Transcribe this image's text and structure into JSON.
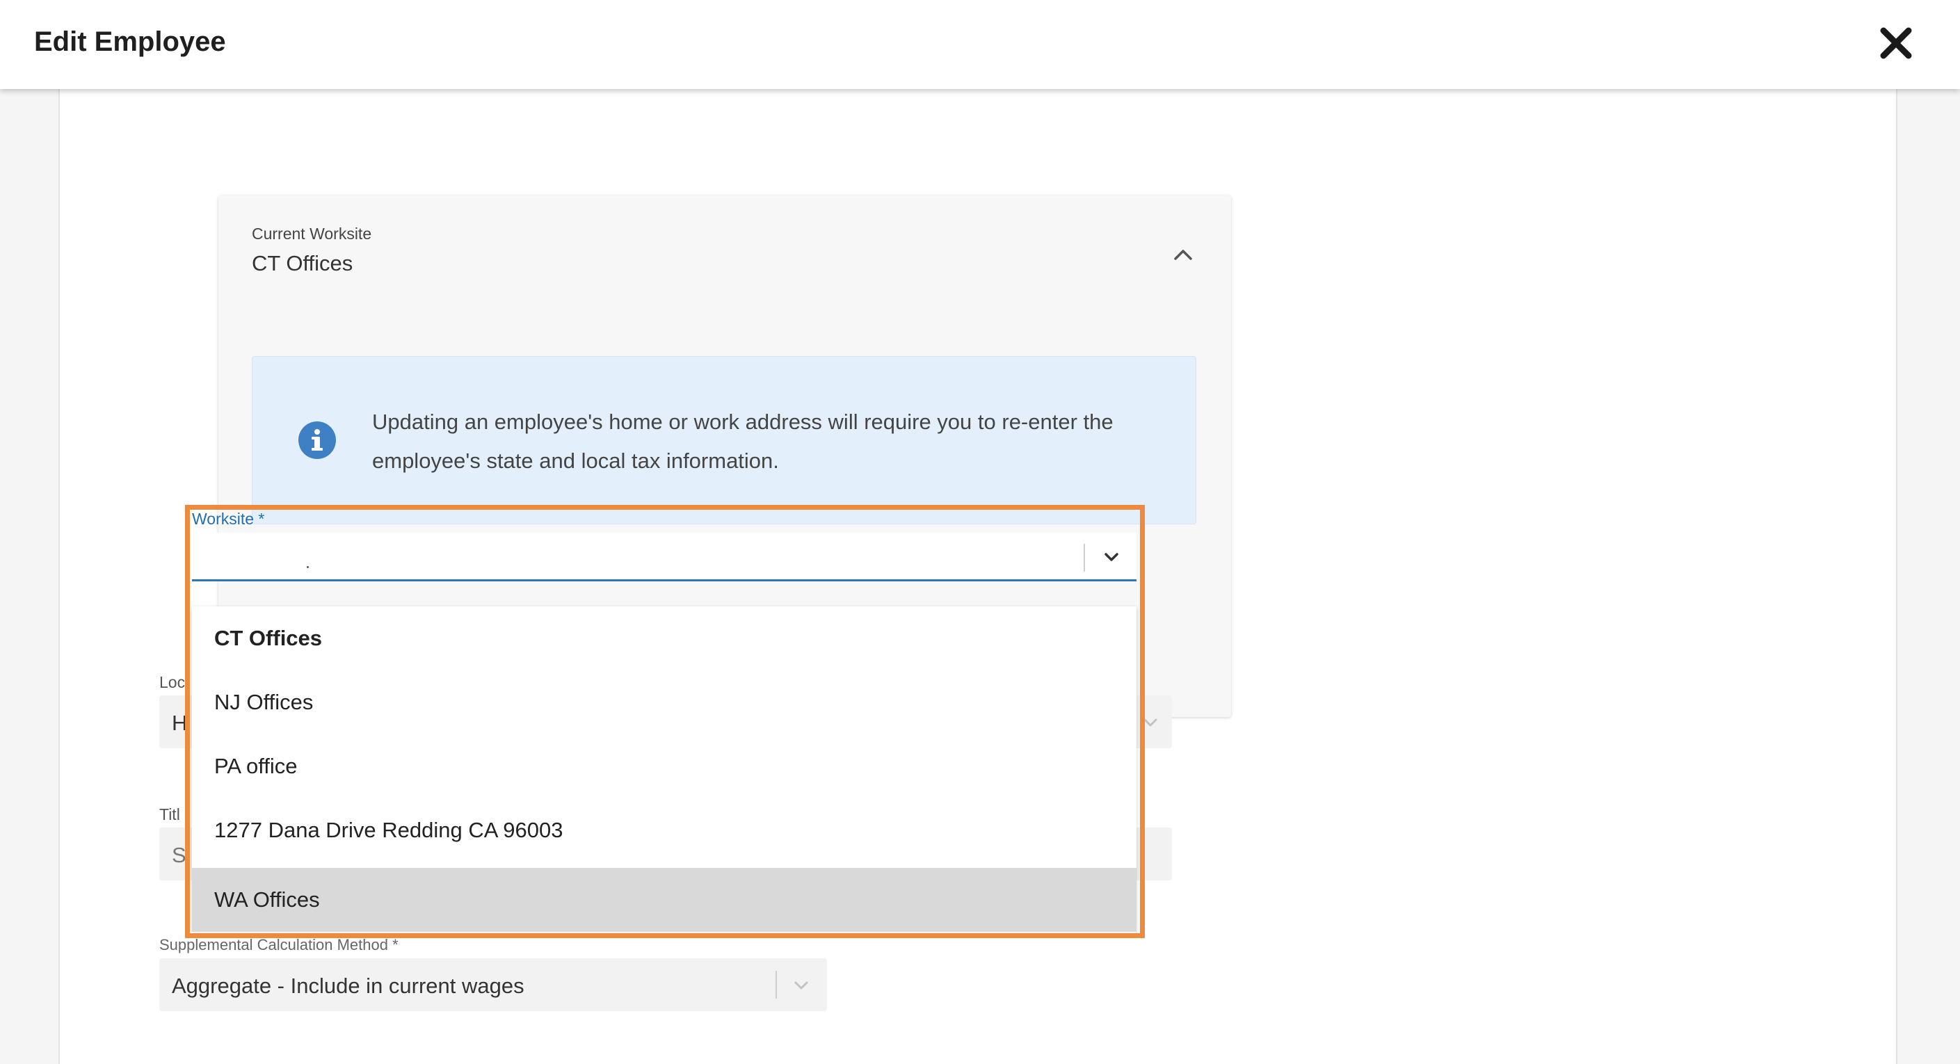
{
  "header": {
    "title": "Edit Employee"
  },
  "current_worksite": {
    "label": "Current Worksite",
    "value": "CT Offices"
  },
  "info": {
    "message": "Updating an employee's home or work address will require you to re-enter the employee's state and local tax information."
  },
  "worksite_field": {
    "label": "Worksite *",
    "value": "",
    "options": [
      {
        "label": "CT Offices",
        "selected": true
      },
      {
        "label": "NJ Offices",
        "selected": false
      },
      {
        "label": "PA office",
        "selected": false
      },
      {
        "label": "1277 Dana Drive Redding CA 96003",
        "selected": false
      },
      {
        "label": "WA Offices",
        "selected": false,
        "hovered": true
      }
    ]
  },
  "location_field": {
    "label_fragment": "Loc",
    "value_fragment": "H"
  },
  "title_field": {
    "label_fragment": "Titl",
    "value_fragment": "S"
  },
  "supplemental_field": {
    "label": "Supplemental Calculation Method *",
    "value": "Aggregate - Include in current wages"
  },
  "colors": {
    "accent": "#2a77b9",
    "highlight": "#ee8a3d",
    "info_bg": "#e3f0fc",
    "info_icon": "#3f7fc4",
    "hover_bg": "#d9d9d9"
  },
  "icons": {
    "close": "close-icon",
    "collapse": "chevron-up-icon",
    "info": "info-icon",
    "dropdown": "chevron-down-icon"
  }
}
